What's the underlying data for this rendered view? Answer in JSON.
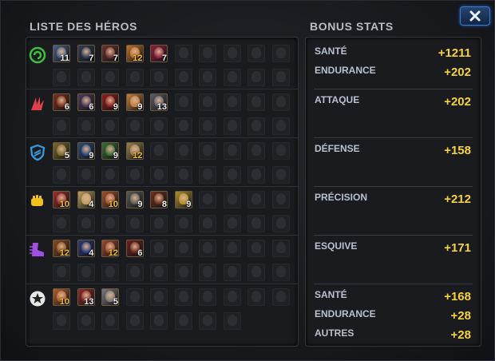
{
  "window": {
    "close_icon": "close-x-icon"
  },
  "heroes_list": {
    "title": "LISTE DES HÉROS",
    "rows": [
      {
        "class_icon": "mystic-spiral-icon",
        "class_color": "#3fbf3f",
        "row_bg": "#1f2a1f",
        "levels": [
          [
            "11",
            "white"
          ],
          [
            "7",
            "white"
          ],
          [
            "7",
            "white"
          ],
          [
            "12",
            "gold"
          ],
          [
            "7",
            "white"
          ]
        ],
        "colors": [
          "#4a5f8a",
          "#2f3b5a",
          "#6a3030",
          "#c07030",
          "#8a2040"
        ],
        "total_slots": 20
      },
      {
        "class_icon": "combat-claw-icon",
        "class_color": "#e0404a",
        "row_bg": "#2a1c1e",
        "levels": [
          [
            "6",
            "white"
          ],
          [
            "6",
            "white"
          ],
          [
            "9",
            "white"
          ],
          [
            "9",
            "white"
          ],
          [
            "13",
            "white"
          ]
        ],
        "colors": [
          "#7a3020",
          "#4a3a5a",
          "#8a2020",
          "#c08040",
          "#5a5a6a"
        ],
        "total_slots": 20
      },
      {
        "class_icon": "tech-shield-icon",
        "class_color": "#3a9ae0",
        "row_bg": "#1a2430",
        "levels": [
          [
            "5",
            "white"
          ],
          [
            "9",
            "white"
          ],
          [
            "9",
            "white"
          ],
          [
            "12",
            "gold"
          ]
        ],
        "colors": [
          "#7a6a30",
          "#2a4a7a",
          "#3a6a3a",
          "#9a8050"
        ],
        "total_slots": 20
      },
      {
        "class_icon": "blaster-fist-icon",
        "class_color": "#f0c020",
        "row_bg": "#2a2618",
        "levels": [
          [
            "10",
            "gold"
          ],
          [
            "4",
            "white"
          ],
          [
            "10",
            "gold"
          ],
          [
            "9",
            "white"
          ],
          [
            "8",
            "white"
          ],
          [
            "9",
            "white"
          ]
        ],
        "colors": [
          "#9a3030",
          "#c0a060",
          "#a05030",
          "#5a5a5a",
          "#6a3020",
          "#b09030"
        ],
        "total_slots": 20
      },
      {
        "class_icon": "speed-boot-icon",
        "class_color": "#a050e0",
        "row_bg": "#241a2e",
        "levels": [
          [
            "12",
            "gold"
          ],
          [
            "4",
            "white"
          ],
          [
            "12",
            "gold"
          ],
          [
            "6",
            "white"
          ]
        ],
        "colors": [
          "#8a4a20",
          "#2a3a7a",
          "#9a4a30",
          "#6a2020"
        ],
        "total_slots": 20
      },
      {
        "class_icon": "universal-star-icon",
        "class_color": "#e8e8e8",
        "row_bg": "#222326",
        "levels": [
          [
            "10",
            "gold"
          ],
          [
            "13",
            "white"
          ],
          [
            "5",
            "white"
          ]
        ],
        "colors": [
          "#b06030",
          "#8a2a2a",
          "#7a7a7a"
        ],
        "total_slots": 18
      }
    ]
  },
  "bonus_stats": {
    "title": "BONUS STATS",
    "groups": [
      {
        "items": [
          {
            "label": "SANTÉ",
            "value": "+1211"
          },
          {
            "label": "ENDURANCE",
            "value": "+202"
          }
        ]
      },
      {
        "items": [
          {
            "label": "ATTAQUE",
            "value": "+202"
          }
        ]
      },
      {
        "items": [
          {
            "label": "DÉFENSE",
            "value": "+158"
          }
        ]
      },
      {
        "items": [
          {
            "label": "PRÉCISION",
            "value": "+212"
          }
        ]
      },
      {
        "items": [
          {
            "label": "ESQUIVE",
            "value": "+171"
          }
        ]
      },
      {
        "items": [
          {
            "label": "SANTÉ",
            "value": "+168"
          },
          {
            "label": "ENDURANCE",
            "value": "+28"
          },
          {
            "label": "AUTRES",
            "value": "+28"
          }
        ]
      }
    ]
  }
}
